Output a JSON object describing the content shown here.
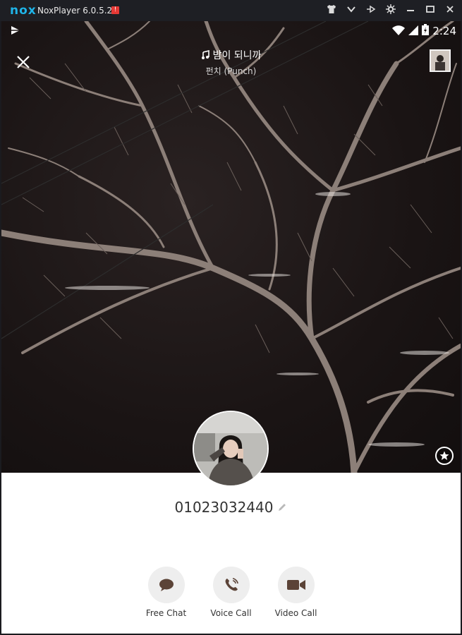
{
  "window": {
    "logo": "nox",
    "title": "NoxPlayer 6.0.5.2",
    "warning_badge": "!",
    "controls": [
      "tshirt-icon",
      "chevron-down-icon",
      "pin-icon",
      "gear-icon",
      "minimize-icon",
      "maximize-icon",
      "close-icon"
    ]
  },
  "status_bar": {
    "time": "2:24",
    "icons": [
      "play-store-icon",
      "wifi-icon",
      "signal-icon",
      "battery-charging-icon"
    ]
  },
  "profile": {
    "music_title": "밤이 되니까",
    "music_artist": "펀치 (Punch)",
    "phone_number": "01023032440"
  },
  "actions": [
    {
      "label": "Free Chat",
      "icon": "chat-bubble-icon"
    },
    {
      "label": "Voice Call",
      "icon": "phone-icon"
    },
    {
      "label": "Video Call",
      "icon": "video-camera-icon"
    }
  ],
  "colors": {
    "accent": "#5b4337",
    "action_bg": "#eeeeee",
    "titlebar_bg": "#1e1f24",
    "nox_logo": "#1fb4e8"
  }
}
